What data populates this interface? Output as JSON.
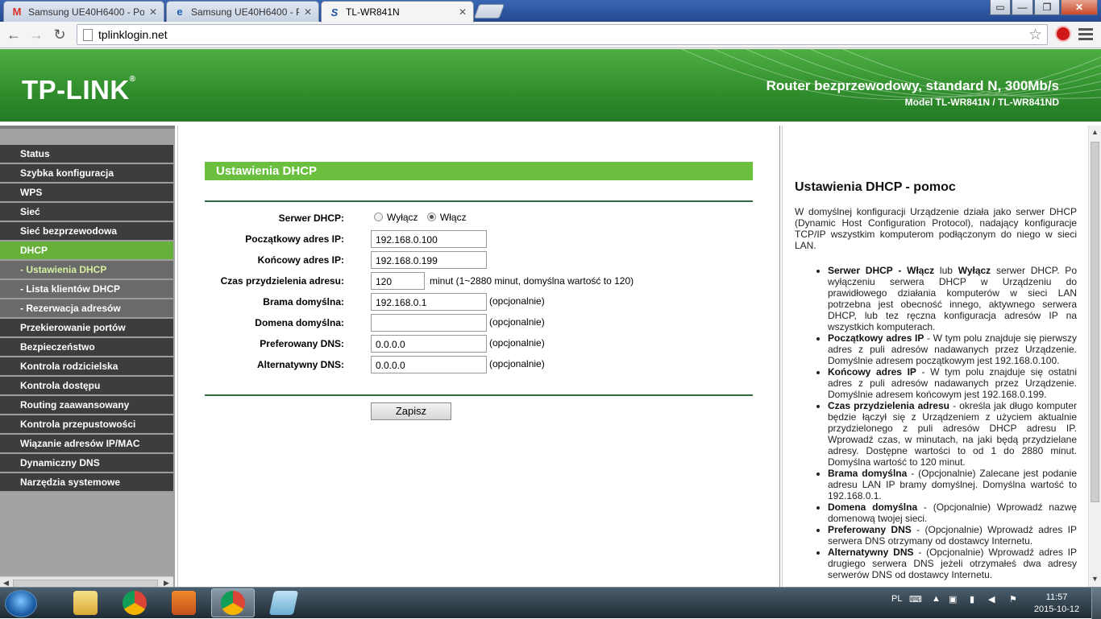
{
  "browser": {
    "tabs": [
      {
        "title": "Samsung UE40H6400 - Po",
        "icon": "gmail-icon"
      },
      {
        "title": "Samsung UE40H6400 - Po",
        "icon": "ie-icon"
      },
      {
        "title": "TL-WR841N",
        "icon": "tplink-favicon"
      }
    ],
    "url": "tplinklogin.net"
  },
  "banner": {
    "logo": "TP-LINK",
    "tagline": "Router bezprzewodowy, standard N, 300Mb/s",
    "model": "Model TL-WR841N / TL-WR841ND"
  },
  "menu": [
    "Status",
    "Szybka konfiguracja",
    "WPS",
    "Sieć",
    "Sieć bezprzewodowa",
    "DHCP",
    "- Ustawienia DHCP",
    "- Lista klientów DHCP",
    "- Rezerwacja adresów",
    "Przekierowanie portów",
    "Bezpieczeństwo",
    "Kontrola rodzicielska",
    "Kontrola dostępu",
    "Routing zaawansowany",
    "Kontrola przepustowości",
    "Wiązanie adresów IP/MAC",
    "Dynamiczny DNS",
    "Narzędzia systemowe"
  ],
  "form": {
    "title": "Ustawienia DHCP",
    "server_label": "Serwer DHCP:",
    "server_off": "Wyłącz",
    "server_on": "Włącz",
    "server_selected": "Włącz",
    "start_label": "Początkowy adres IP:",
    "start_value": "192.168.0.100",
    "end_label": "Końcowy adres IP:",
    "end_value": "192.168.0.199",
    "lease_label": "Czas przydzielenia adresu:",
    "lease_value": "120",
    "lease_note": "minut (1~2880 minut, domyślna wartość to 120)",
    "gateway_label": "Brama domyślna:",
    "gateway_value": "192.168.0.1",
    "domain_label": "Domena domyślna:",
    "domain_value": "",
    "dns1_label": "Preferowany DNS:",
    "dns1_value": "0.0.0.0",
    "dns2_label": "Alternatywny DNS:",
    "dns2_value": "0.0.0.0",
    "optional": "(opcjonalnie)",
    "save": "Zapisz"
  },
  "help": {
    "title": "Ustawienia DHCP - pomoc",
    "intro": "W domyślnej konfiguracji Urządzenie działa jako serwer DHCP (Dynamic Host Configuration Protocol), nadający konfiguracje TCP/IP wszystkim komputerom podłączonym do niego w sieci LAN.",
    "items": [
      {
        "term": "Serwer DHCP - Włącz",
        "mid": " lub ",
        "term2": "Wyłącz",
        "text": " serwer DHCP. Po wyłączeniu serwera DHCP w Urządzeniu do prawidłowego działania komputerów w sieci LAN potrzebna jest obecność innego, aktywnego serwera DHCP, lub tez ręczna konfiguracja adresów IP na wszystkich komputerach."
      },
      {
        "term": "Początkowy adres IP",
        "text": " - W tym polu znajduje się pierwszy adres z puli adresów nadawanych przez Urządzenie. Domyślnie adresem początkowym jest 192.168.0.100."
      },
      {
        "term": "Końcowy adres IP",
        "text": " - W tym polu znajduje się ostatni adres z puli adresów nadawanych przez Urządzenie. Domyślnie adresem końcowym jest 192.168.0.199."
      },
      {
        "term": "Czas przydzielenia adresu",
        "text": " - określa jak długo komputer będzie łączył się z Urządzeniem z użyciem aktualnie przydzielonego z puli adresów DHCP adresu IP. Wprowadź czas, w minutach, na jaki będą przydzielane adresy. Dostępne wartości to od 1 do 2880 minut. Domyślna wartość to 120 minut."
      },
      {
        "term": "Brama domyślna",
        "text": " - (Opcjonalnie) Zalecane jest podanie adresu LAN IP bramy domyślnej. Domyślna wartość to 192.168.0.1."
      },
      {
        "term": "Domena domyślna",
        "text": " - (Opcjonalnie) Wprowadź nazwę domenową twojej sieci."
      },
      {
        "term": "Preferowany DNS",
        "text": " - (Opcjonalnie) Wprowadź adres IP serwera DNS otrzymany od dostawcy Internetu."
      },
      {
        "term": "Alternatywny DNS",
        "text": " - (Opcjonalnie) Wprowadź adres IP drugiego serwera DNS jeżeli otrzymałeś dwa adresy serwerów DNS od dostawcy Internetu."
      }
    ]
  },
  "taskbar": {
    "language": "PL",
    "time": "11:57",
    "date": "2015-10-12"
  },
  "colors": {
    "banner_green": "#3a9a35",
    "menu_active": "#67b13a",
    "menu_bg": "#3d3d3d",
    "section_green": "#6abf3f"
  }
}
